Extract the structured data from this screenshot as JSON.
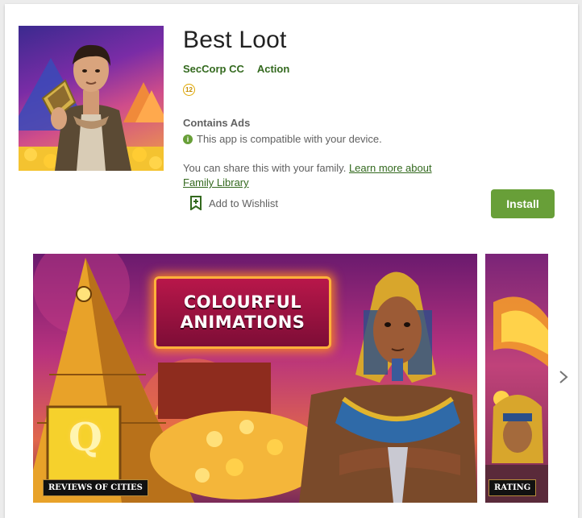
{
  "app": {
    "title": "Best Loot",
    "developer": "SecCorp CC",
    "category": "Action",
    "age_rating": "12",
    "contains_ads": "Contains Ads",
    "compatibility": "This app is compatible with your device.",
    "family_text": "You can share this with your family.",
    "family_link": "Learn more about Family Library",
    "wishlist_label": "Add to Wishlist",
    "install_label": "Install"
  },
  "screenshots": [
    {
      "banner_line1": "COLOURFUL",
      "banner_line2": "ANIMATIONS",
      "caption": "REVIEWS OF CITIES",
      "pyramid_letter": "Q"
    },
    {
      "caption": "RATING"
    }
  ],
  "colors": {
    "accent": "#689f38",
    "link": "#33691e",
    "title": "#212121",
    "muted": "#616161",
    "age_badge": "#e0a800"
  },
  "icons": {
    "info": "info-icon",
    "wishlist": "bookmark-plus-icon",
    "next": "chevron-right-icon"
  }
}
